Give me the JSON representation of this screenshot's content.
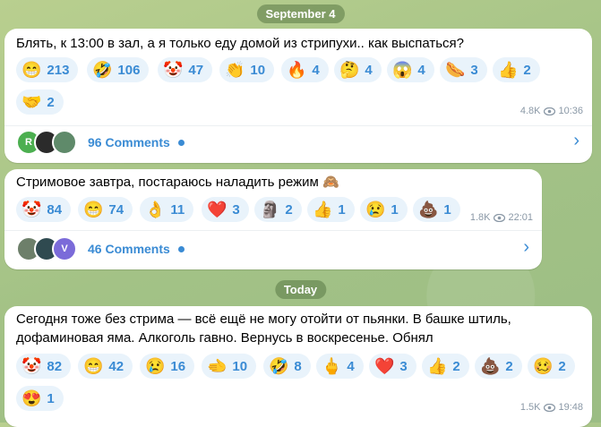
{
  "dates": {
    "first": "September 4",
    "second": "Today"
  },
  "messages": [
    {
      "text": "Блять, к 13:00 в зал, а я только еду домой из стрипухи.. как выспаться?",
      "reactions": [
        {
          "emoji": "😁",
          "count": "213"
        },
        {
          "emoji": "🤣",
          "count": "106"
        },
        {
          "emoji": "🤡",
          "count": "47"
        },
        {
          "emoji": "👏",
          "count": "10"
        },
        {
          "emoji": "🔥",
          "count": "4"
        },
        {
          "emoji": "🤔",
          "count": "4"
        },
        {
          "emoji": "😱",
          "count": "4"
        },
        {
          "emoji": "🌭",
          "count": "3"
        },
        {
          "emoji": "👍",
          "count": "2"
        },
        {
          "emoji": "🤝",
          "count": "2"
        }
      ],
      "views": "4.8K",
      "time": "10:36",
      "comments": "96 Comments",
      "avatar_letter": "R"
    },
    {
      "text": "Стримовое завтра, постараюсь наладить режим 🙈",
      "reactions": [
        {
          "emoji": "🤡",
          "count": "84"
        },
        {
          "emoji": "😁",
          "count": "74"
        },
        {
          "emoji": "👌",
          "count": "11"
        },
        {
          "emoji": "❤️",
          "count": "3"
        },
        {
          "emoji": "🗿",
          "count": "2"
        },
        {
          "emoji": "👍",
          "count": "1"
        },
        {
          "emoji": "😢",
          "count": "1"
        },
        {
          "emoji": "💩",
          "count": "1"
        }
      ],
      "views": "1.8K",
      "time": "22:01",
      "comments": "46 Comments",
      "avatar_letter": "V"
    },
    {
      "text": "Сегодня тоже без стрима — всё ещё не могу отойти от пьянки. В башке штиль, дофаминовая яма. Алкоголь гавно. Вернусь в воскресенье. Обнял",
      "reactions": [
        {
          "emoji": "🤡",
          "count": "82"
        },
        {
          "emoji": "😁",
          "count": "42"
        },
        {
          "emoji": "😢",
          "count": "16"
        },
        {
          "emoji": "🫲",
          "count": "10"
        },
        {
          "emoji": "🤣",
          "count": "8"
        },
        {
          "emoji": "🖕",
          "count": "4"
        },
        {
          "emoji": "❤️",
          "count": "3"
        },
        {
          "emoji": "👍",
          "count": "2"
        },
        {
          "emoji": "💩",
          "count": "2"
        },
        {
          "emoji": "🥴",
          "count": "2"
        },
        {
          "emoji": "😍",
          "count": "1"
        }
      ],
      "views": "1.5K",
      "time": "19:48"
    }
  ]
}
